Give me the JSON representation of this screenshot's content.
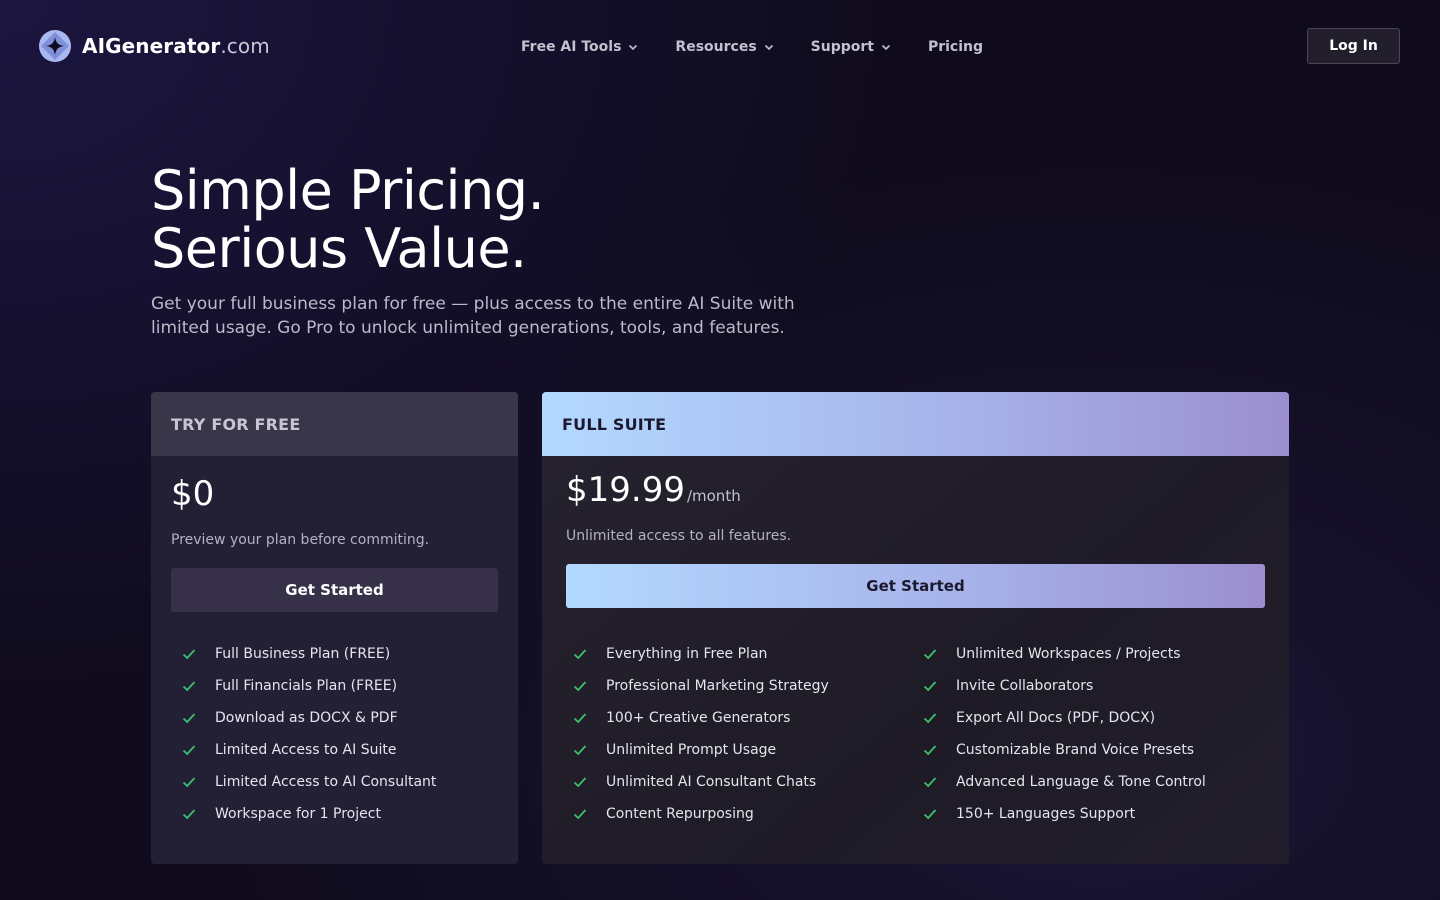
{
  "nav": {
    "brand": "AIGenerator",
    "tld": ".com",
    "logo_icon": "sparkle-diamond-icon",
    "menu": [
      {
        "label": "Free AI Tools",
        "has_dropdown": true
      },
      {
        "label": "Resources",
        "has_dropdown": true
      },
      {
        "label": "Support",
        "has_dropdown": true
      },
      {
        "label": "Pricing",
        "has_dropdown": false
      }
    ],
    "login_label": "Log In"
  },
  "hero": {
    "title_line1": "Simple Pricing.",
    "title_line2": "Serious Value.",
    "subtitle": "Get your full business plan for free — plus access to the entire AI Suite with limited usage. Go Pro to unlock unlimited generations, tools, and features."
  },
  "plans": {
    "free": {
      "header": "TRY FOR FREE",
      "price": "$0",
      "description": "Preview your plan before commiting.",
      "cta": "Get Started",
      "features": [
        "Full Business Plan (FREE)",
        "Full Financials Plan (FREE)",
        "Download as DOCX & PDF",
        "Limited Access to AI Suite",
        "Limited Access to AI Consultant",
        "Workspace for 1 Project"
      ]
    },
    "pro": {
      "header": "FULL SUITE",
      "price": "$19.99",
      "period": "/month",
      "description": "Unlimited access to all features.",
      "cta": "Get Started",
      "features_col1": [
        "Everything in Free Plan",
        "Professional Marketing Strategy",
        "100+ Creative Generators",
        "Unlimited Prompt Usage",
        "Unlimited AI Consultant Chats",
        "Content Repurposing"
      ],
      "features_col2": [
        "Unlimited Workspaces / Projects",
        "Invite Collaborators",
        "Export All Docs (PDF, DOCX)",
        "Customizable Brand Voice Presets",
        "Advanced Language & Tone Control",
        "150+ Languages Support"
      ]
    }
  },
  "colors": {
    "accent_gradient_start": "#b3d9ff",
    "accent_gradient_end": "#9b8ed0",
    "check_green": "#3fbf6a",
    "background": "#0f0b1c"
  }
}
